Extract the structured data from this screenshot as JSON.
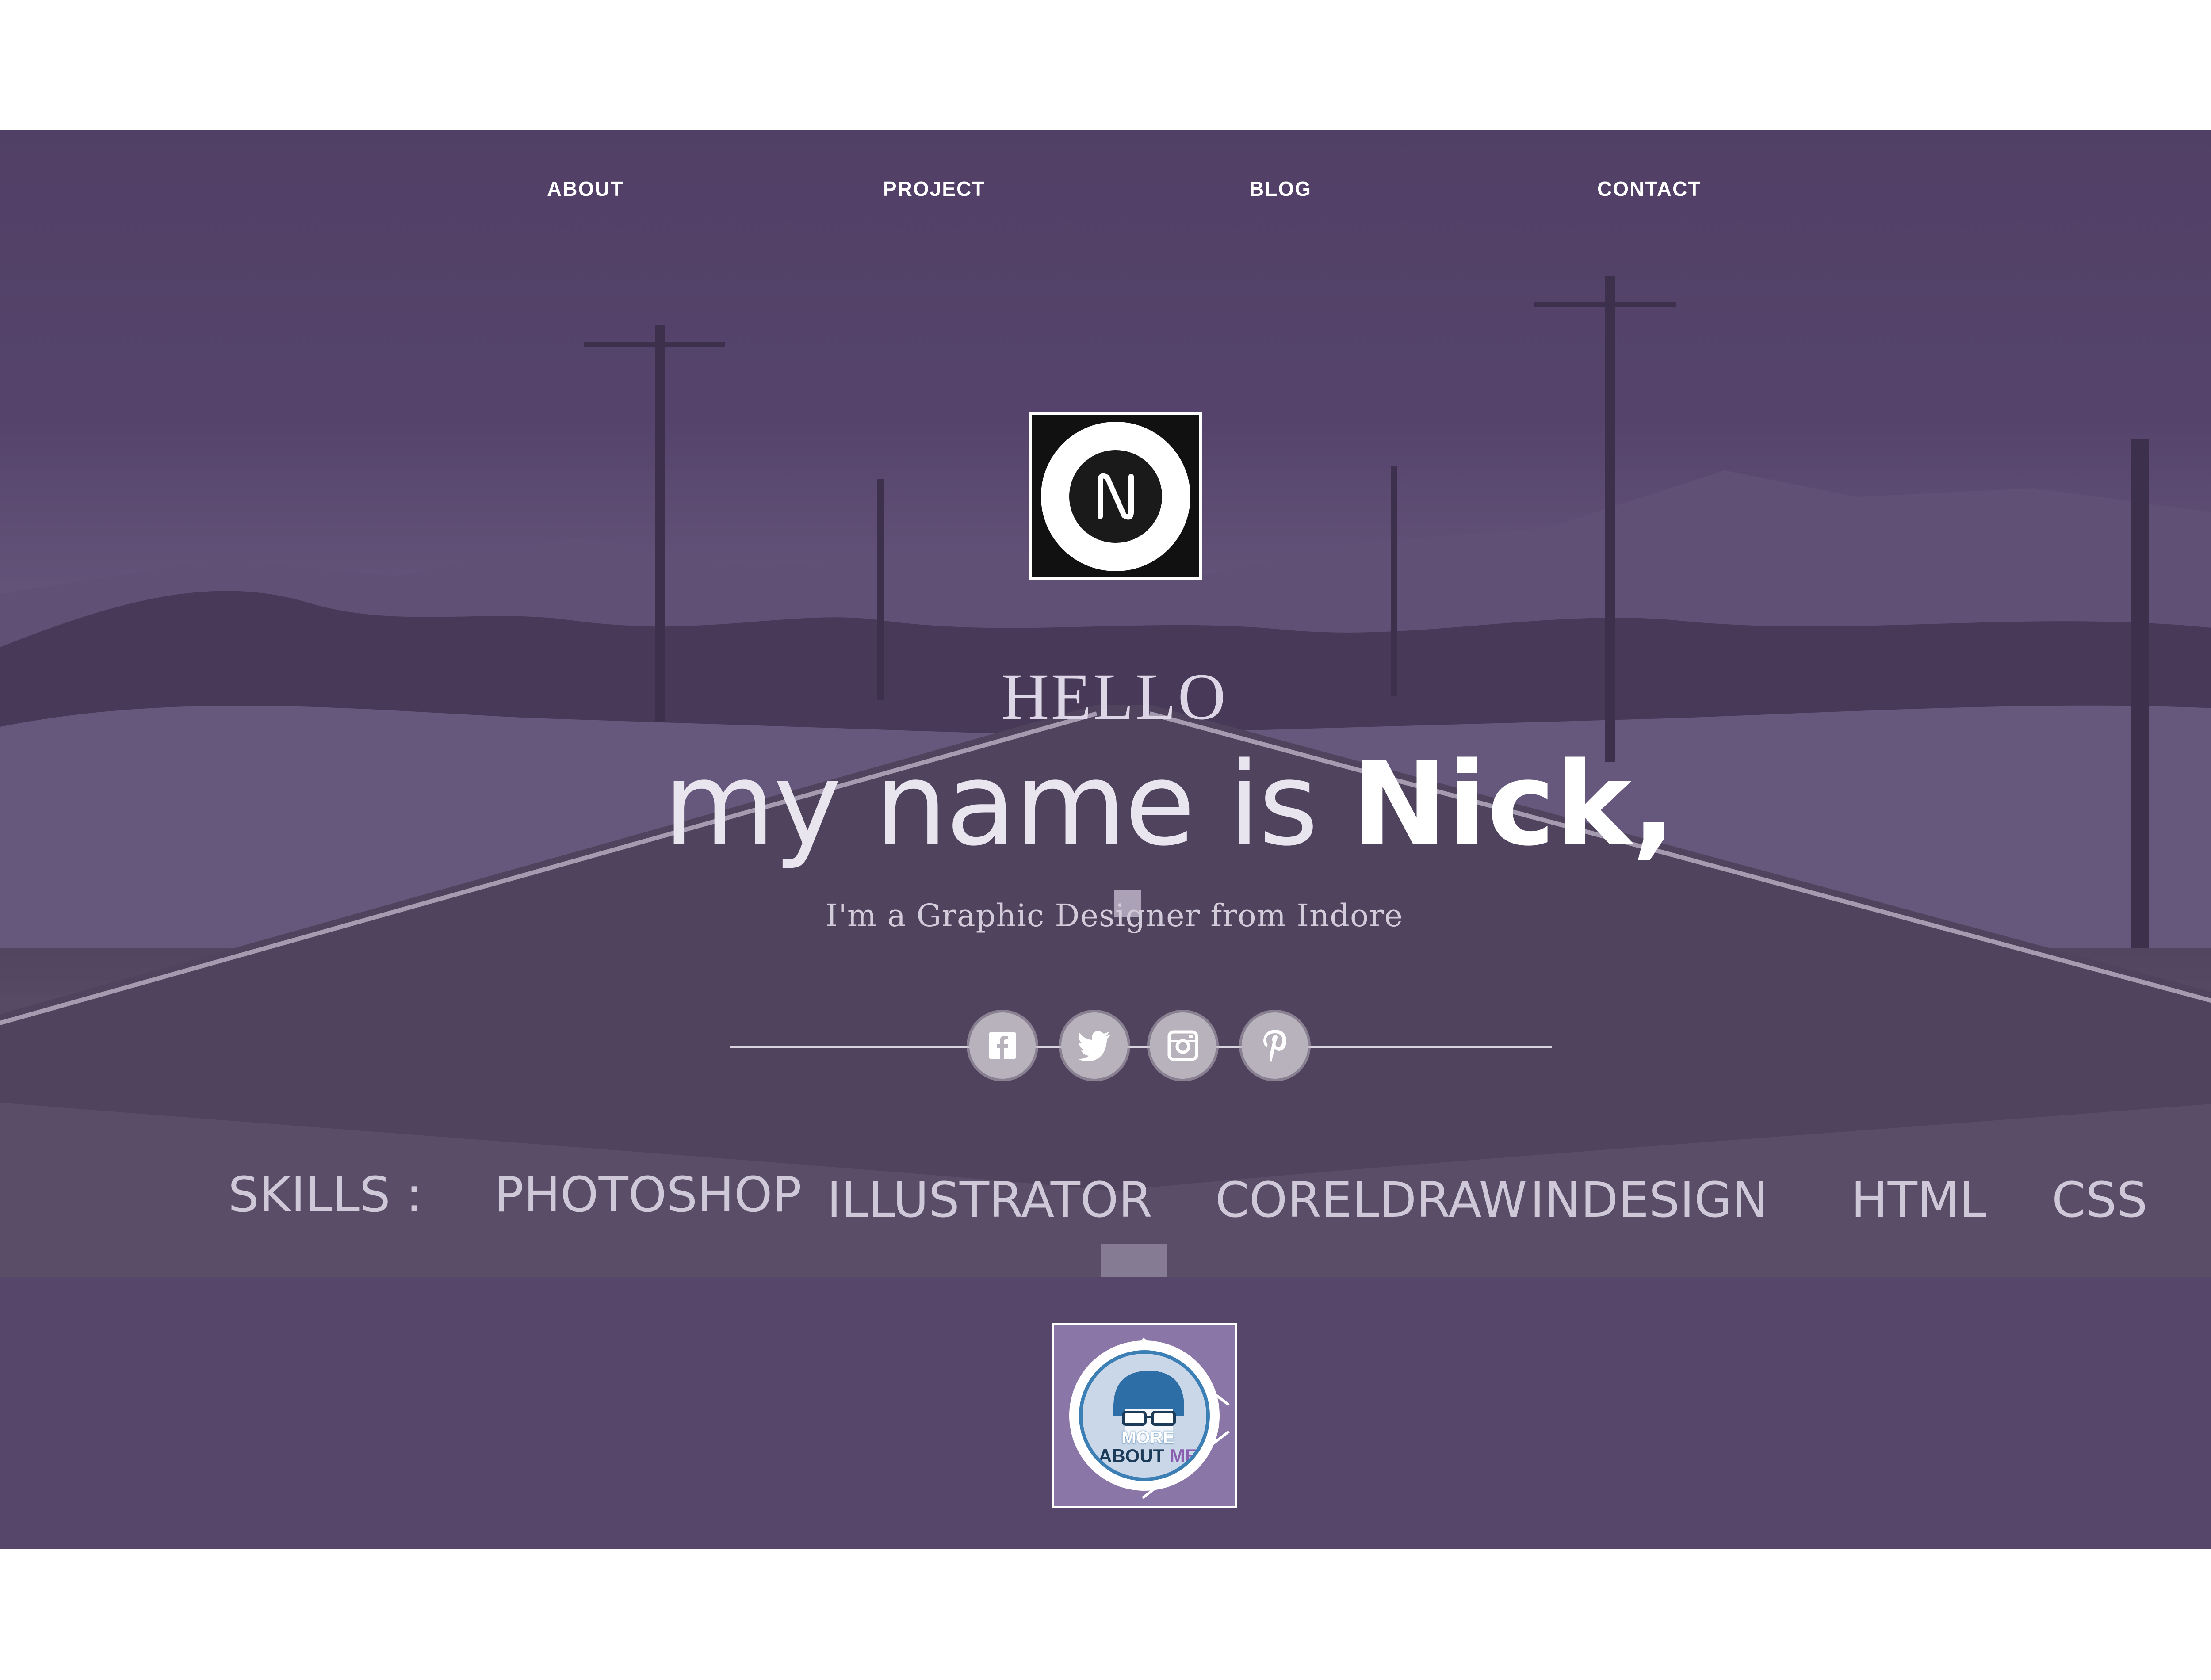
{
  "nav": {
    "items": [
      {
        "label": "ABOUT"
      },
      {
        "label": "PROJECT"
      },
      {
        "label": "BLOG"
      },
      {
        "label": "CONTACT"
      }
    ]
  },
  "hero": {
    "logo_letter": "N",
    "hello": "HELLO",
    "headline_light": "my name is ",
    "headline_bold": "Nick,",
    "tagline": "I'm a Graphic Designer from Indore"
  },
  "social": {
    "icons": [
      "facebook-icon",
      "twitter-icon",
      "instagram-icon",
      "pinterest-icon"
    ],
    "glyphs": [
      "f",
      "🐦",
      "◙",
      "P"
    ]
  },
  "skills": {
    "label": "SKILLS :",
    "items": [
      "PHOTOSHOP",
      "ILLUSTRATOR",
      "CORELDRAW",
      "INDESIGN",
      "HTML",
      "CSS"
    ]
  },
  "more_about": {
    "line1": "MORE",
    "line2a": "ABOUT",
    "line2b": "ME"
  },
  "colors": {
    "band": "#564669",
    "more_box": "#8b76a8",
    "accent_blue": "#3c7fb5"
  }
}
